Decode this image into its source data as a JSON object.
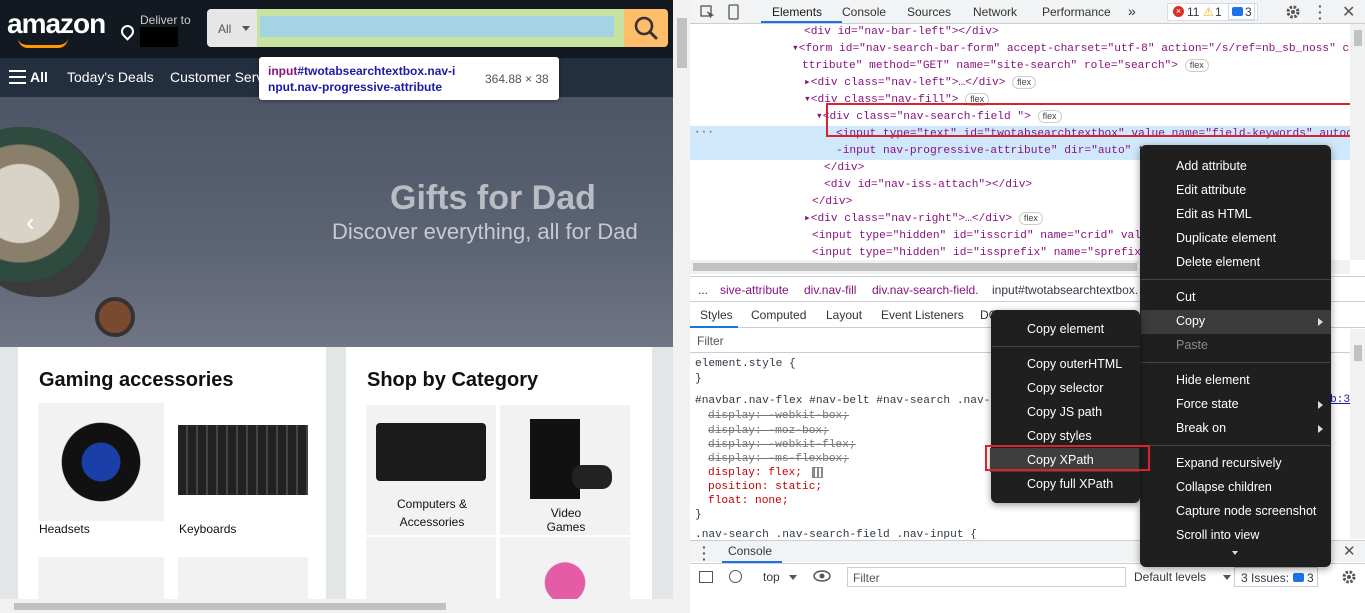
{
  "amazon": {
    "logo": "amazon",
    "deliver_to": "Deliver to",
    "search_category": "All",
    "nav": {
      "all": "All",
      "deals": "Today's Deals",
      "customer_service": "Customer Serv"
    },
    "tooltip": {
      "tag": "input",
      "selector_line1": "#twotabsearchtextbox.nav-i",
      "selector_line2": "nput.nav-progressive-attribute",
      "dimensions": "364.88 × 38"
    },
    "hero": {
      "title": "Gifts for Dad",
      "subtitle": "Discover everything, all for Dad"
    },
    "card_gaming": {
      "title": "Gaming accessories",
      "items": [
        "Headsets",
        "Keyboards"
      ]
    },
    "card_category": {
      "title": "Shop by Category",
      "items": [
        "Computers &",
        "Accessories",
        "Video Games"
      ]
    }
  },
  "devtools": {
    "tabs": [
      "Elements",
      "Console",
      "Sources",
      "Network",
      "Performance",
      "»"
    ],
    "errors": "11",
    "warnings": "1",
    "messages": "3",
    "elements_lines": [
      {
        "text": "<div id=\"nav-bar-left\"></div>"
      },
      {
        "text": "▾<form id=\"nav-search-bar-form\" accept-charset=\"utf-8\" action=\"/s/ref=nb_sb_noss\" cl"
      },
      {
        "text": "ttribute\" method=\"GET\" name=\"site-search\" role=\"search\">"
      },
      {
        "text": "▸<div class=\"nav-left\">…</div>"
      },
      {
        "text": "▾<div class=\"nav-fill\">"
      },
      {
        "text": "▾<div class=\"nav-search-field \">"
      },
      {
        "text": "<input type=\"text\" id=\"twotabsearchtextbox\" value name=\"field-keywords\" autoco"
      },
      {
        "text": "-input nav-progressive-attribute\" dir=\"auto\" t"
      },
      {
        "text": "</div>"
      },
      {
        "text": "<div id=\"nav-iss-attach\"></div>"
      },
      {
        "text": "</div>"
      },
      {
        "text": "▸<div class=\"nav-right\">…</div>"
      },
      {
        "text": "<input type=\"hidden\" id=\"isscrid\" name=\"crid\" valu"
      },
      {
        "text": "<input type=\"hidden\" id=\"issprefix\" name=\"sprefix\" v"
      }
    ],
    "flex_badge": "flex",
    "breadcrumbs": [
      "...",
      "sive-attribute",
      "div.nav-fill",
      "div.nav-search-field.",
      "input#twotabsearchtextbox."
    ],
    "styles_tabs": [
      "Styles",
      "Computed",
      "Layout",
      "Event Listeners",
      "DO"
    ],
    "filter_placeholder": "Filter",
    "styles_lines": [
      "element.style {",
      "}",
      "#navbar.nav-flex #nav-belt #nav-search .nav-s",
      "display: -webkit-box;",
      "display: -moz-box;",
      "display: -webkit-flex;",
      "display: -ms-flexbox;",
      "display: flex;",
      "position: static;",
      "float: none;",
      "}",
      ".nav-search .nav-search-field .nav-input {"
    ],
    "styles_source_ref": "b:3",
    "console_tab": "Console",
    "console_context": "top",
    "console_filter": "Filter",
    "default_levels": "Default levels",
    "issues": "3 Issues:",
    "issues_count": "3"
  },
  "context_menu": {
    "items": [
      "Add attribute",
      "Edit attribute",
      "Edit as HTML",
      "Duplicate element",
      "Delete element",
      "Cut",
      "Copy",
      "Paste",
      "Hide element",
      "Force state",
      "Break on",
      "Expand recursively",
      "Collapse children",
      "Capture node screenshot",
      "Scroll into view"
    ]
  },
  "copy_submenu": {
    "items": [
      "Copy element",
      "Copy outerHTML",
      "Copy selector",
      "Copy JS path",
      "Copy styles",
      "Copy XPath",
      "Copy full XPath"
    ]
  }
}
